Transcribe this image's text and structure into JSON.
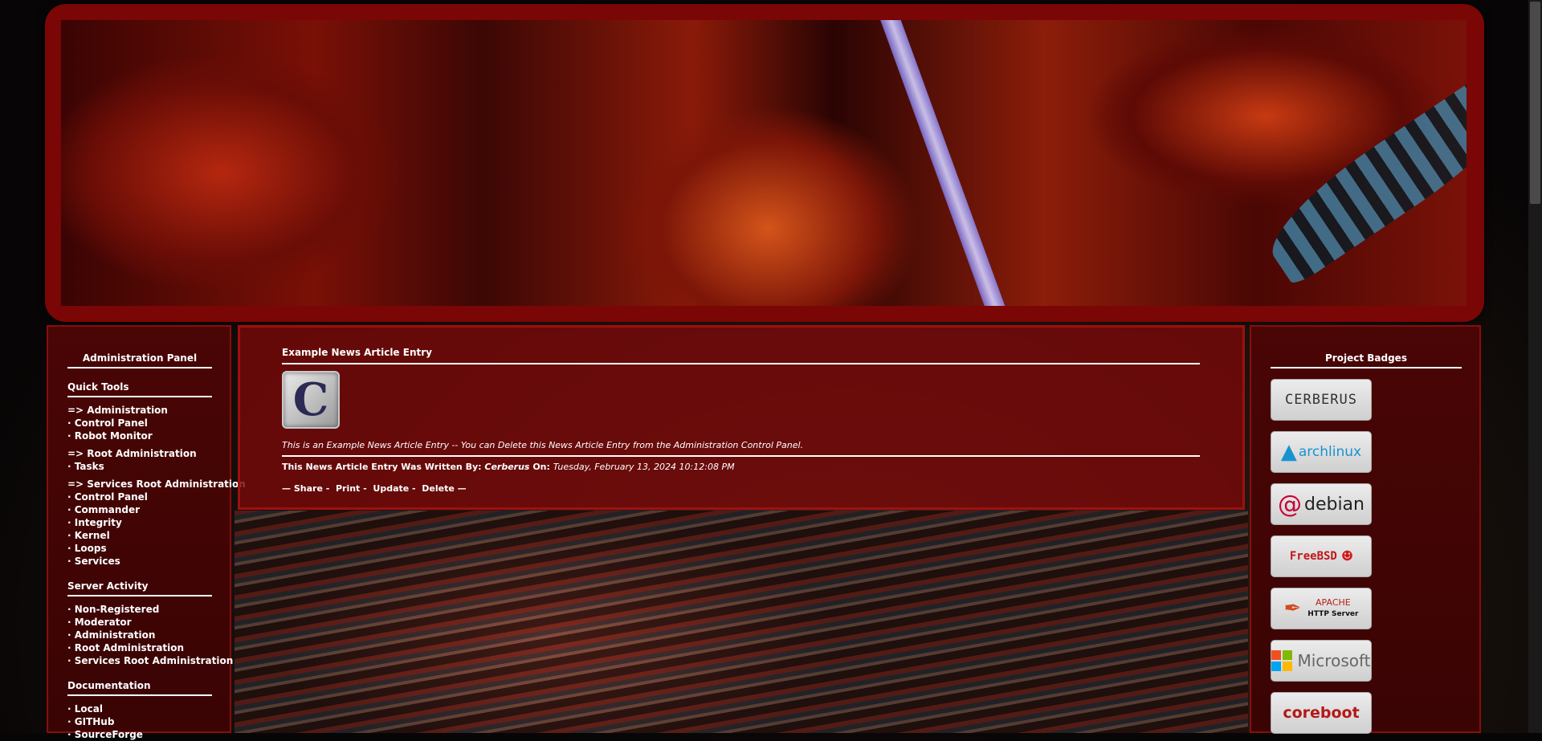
{
  "left_panel": {
    "title": "Administration Panel",
    "sections": [
      {
        "heading": "Quick Tools",
        "groups": [
          [
            "=> Administration",
            "· Control Panel",
            "· Robot Monitor"
          ],
          [
            "=> Root Administration",
            "· Tasks"
          ],
          [
            "=> Services Root Administration",
            "· Control Panel",
            "· Commander",
            "· Integrity",
            "· Kernel",
            "· Loops",
            "· Services"
          ]
        ]
      },
      {
        "heading": "Server Activity",
        "groups": [
          [
            "· Non-Registered",
            "· Moderator",
            "· Administration",
            "· Root Administration",
            "· Services Root Administration"
          ]
        ]
      },
      {
        "heading": "Documentation",
        "groups": [
          [
            "· Local",
            "· GITHub",
            "· SourceForge"
          ]
        ]
      }
    ]
  },
  "article": {
    "title": "Example News Article Entry",
    "logo_letter": "C",
    "body": "This is an Example News Article Entry -- You can Delete this News Article Entry from the Administration Control Panel.",
    "written_by_label": "This News Article Entry Was Written By:",
    "author": "Cerberus",
    "on_label": "On:",
    "date": "Tuesday, February 13, 2024 10:12:08 PM",
    "actions": [
      "Share",
      "Print",
      "Update",
      "Delete"
    ]
  },
  "right_panel": {
    "title": "Project Badges",
    "badges": [
      {
        "name": "cerberus",
        "text": "CERBERUS"
      },
      {
        "name": "archlinux",
        "text": "archlinux"
      },
      {
        "name": "debian",
        "text": "debian"
      },
      {
        "name": "freebsd",
        "text": "FreeBSD"
      },
      {
        "name": "apache",
        "text_line1": "APACHE",
        "text_line2": "HTTP Server"
      },
      {
        "name": "microsoft",
        "text": "Microsoft"
      },
      {
        "name": "coreboot",
        "text": "coreboot"
      }
    ]
  },
  "colors": {
    "panel_bg": "#4a0505",
    "panel_border": "#8a0d0d",
    "banner_frame": "#7a0606",
    "text": "#ffffff"
  },
  "icons": [
    "banner-image",
    "site-logo-icon",
    "archlinux-icon",
    "debian-swirl-icon",
    "freebsd-devil-icon",
    "apache-feather-icon",
    "microsoft-logo-icon"
  ]
}
